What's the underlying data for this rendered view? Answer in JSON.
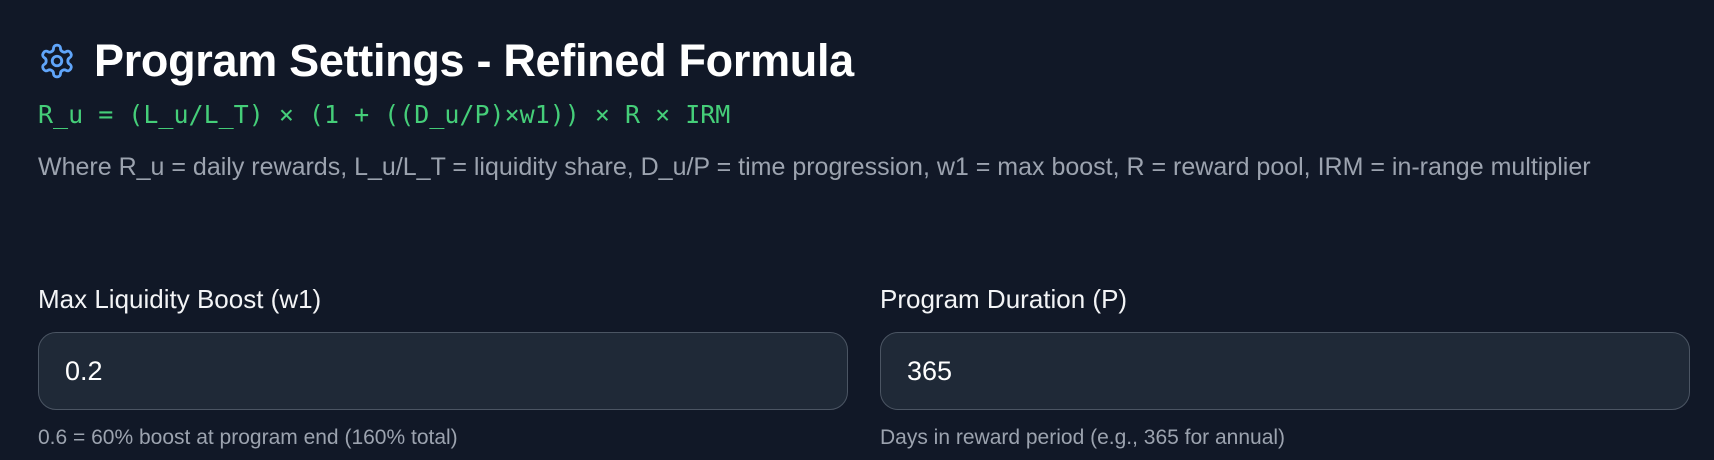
{
  "header": {
    "icon": "gear-icon",
    "icon_color": "#60a5fa",
    "title": "Program Settings - Refined Formula"
  },
  "formula": "R_u = (L_u/L_T) × (1 + ((D_u/P)×w1)) × R × IRM",
  "description": "Where R_u = daily rewards, L_u/L_T = liquidity share, D_u/P = time progression, w1 = max boost, R = reward pool, IRM = in-range multiplier",
  "fields": {
    "max_boost": {
      "label": "Max Liquidity Boost (w1)",
      "value": "0.2",
      "hint": "0.6 = 60% boost at program end (160% total)"
    },
    "duration": {
      "label": "Program Duration (P)",
      "value": "365",
      "hint": "Days in reward period (e.g., 365 for annual)"
    }
  },
  "colors": {
    "background": "#111827",
    "formula": "#4ade80",
    "input_bg": "#1f2937",
    "input_border": "#4b5563",
    "muted_text": "#9ca3af"
  }
}
